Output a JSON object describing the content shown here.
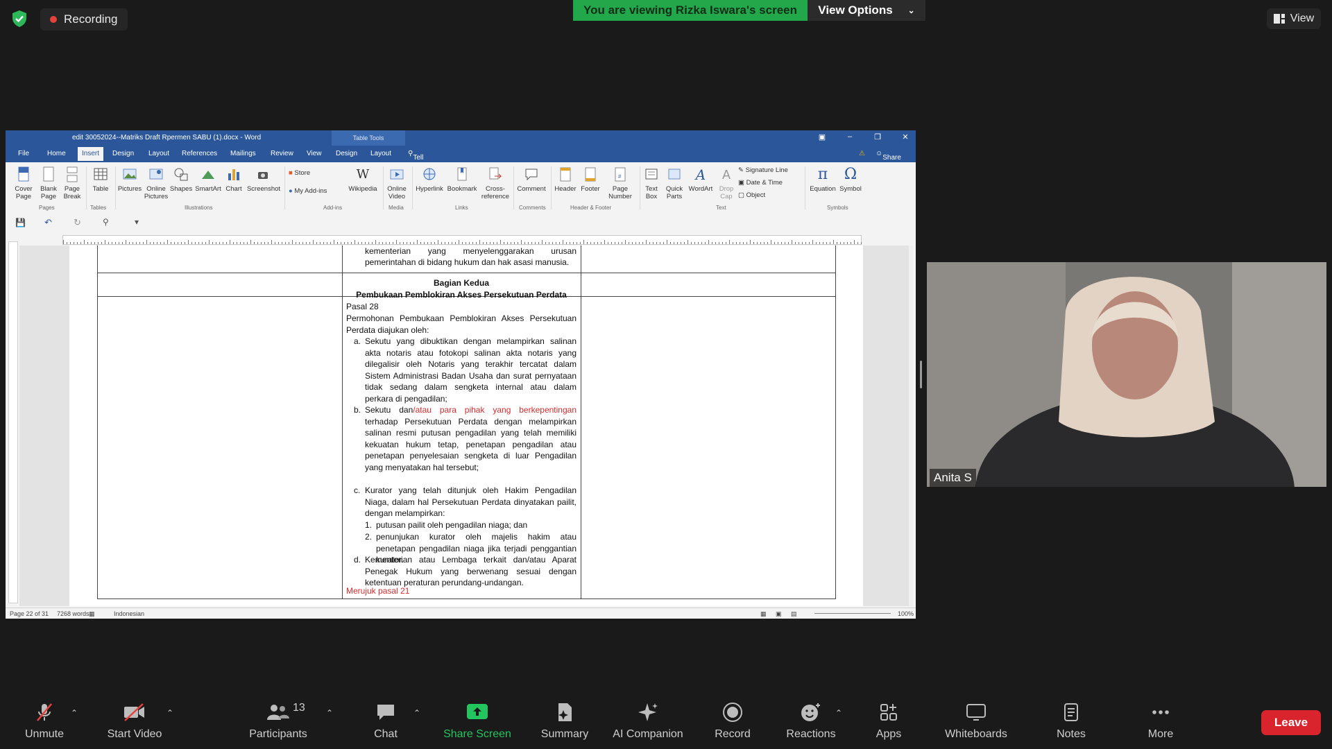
{
  "zoom": {
    "recording_label": "Recording",
    "banner_text": "You are viewing Rizka Iswara's screen",
    "view_options_label": "View Options",
    "view_button_label": "View",
    "participant_name": "Anita S",
    "participants_count": "13",
    "toolbar": {
      "unmute": "Unmute",
      "start_video": "Start Video",
      "participants": "Participants",
      "chat": "Chat",
      "share_screen": "Share Screen",
      "summary": "Summary",
      "ai_companion": "AI Companion",
      "record": "Record",
      "reactions": "Reactions",
      "apps": "Apps",
      "whiteboards": "Whiteboards",
      "notes": "Notes",
      "more": "More",
      "leave": "Leave"
    },
    "colors": {
      "accent_green": "#22a84a",
      "leave_red": "#d9232d",
      "share_green": "#22c55e"
    }
  },
  "word": {
    "title": "edit 30052024--Matriks Draft Rpermen SABU (1).docx - Word",
    "context_tab": "Table Tools",
    "tabs": [
      "File",
      "Home",
      "Insert",
      "Design",
      "Layout",
      "References",
      "Mailings",
      "Review",
      "View",
      "Design",
      "Layout"
    ],
    "tell_me": "Tell me what you want to do...",
    "share": "Share",
    "ribbon": {
      "cover_page": "Cover Page",
      "blank_page": "Blank Page",
      "page_break": "Page Break",
      "table": "Table",
      "pictures": "Pictures",
      "online_pictures": "Online Pictures",
      "shapes": "Shapes",
      "smartart": "SmartArt",
      "chart": "Chart",
      "screenshot": "Screenshot",
      "store": "Store",
      "my_addins": "My Add-ins",
      "wikipedia": "Wikipedia",
      "online_video": "Online Video",
      "hyperlink": "Hyperlink",
      "bookmark": "Bookmark",
      "cross_reference": "Cross-reference",
      "comment": "Comment",
      "header": "Header",
      "footer": "Footer",
      "page_number": "Page Number",
      "text_box": "Text Box",
      "quick_parts": "Quick Parts",
      "wordart": "WordArt",
      "drop_cap": "Drop Cap",
      "signature_line": "Signature Line",
      "date_time": "Date & Time",
      "object": "Object",
      "equation": "Equation",
      "symbol": "Symbol",
      "groups": {
        "pages": "Pages",
        "tables": "Tables",
        "illustrations": "Illustrations",
        "addins": "Add-ins",
        "media": "Media",
        "links": "Links",
        "comments": "Comments",
        "header_footer": "Header & Footer",
        "text": "Text",
        "symbols": "Symbols"
      }
    },
    "document": {
      "top_fragment_1": "kementerian yang menyelenggarakan urusan",
      "top_fragment_2": "pemerintahan di bidang hukum dan hak asasi manusia.",
      "section_title": "Bagian Kedua",
      "section_subtitle": "Pembukaan Pemblokiran Akses Persekutuan Perdata",
      "pasal": "Pasal 28",
      "intro": "Permohonan Pembukaan Pemblokiran Akses Persekutuan Perdata diajukan oleh:",
      "item_a_marker": "a.",
      "item_a": "Sekutu yang dibuktikan dengan melampirkan salinan akta notaris atau fotokopi salinan akta notaris yang dilegalisir oleh Notaris yang terakhir tercatat dalam Sistem Administrasi Badan Usaha dan surat pernyataan tidak sedang dalam sengketa internal atau dalam perkara di pengadilan;",
      "item_b_marker": "b.",
      "item_b_start": "Sekutu dan",
      "item_b_red": "/atau para pihak yang berkepentingan",
      "item_b_rest": "terhadap Persekutuan Perdata dengan melampirkan salinan resmi putusan pengadilan yang telah memiliki kekuatan hukum tetap, penetapan pengadilan atau penetapan penyelesaian sengketa di luar Pengadilan yang menyatakan hal tersebut;",
      "item_c_marker": "c.",
      "item_c": "Kurator yang telah ditunjuk oleh Hakim Pengadilan Niaga, dalam hal Persekutuan Perdata dinyatakan pailit, dengan melampirkan:",
      "sub_1_marker": "1.",
      "sub_1": "putusan pailit oleh pengadilan niaga; dan",
      "sub_2_marker": "2.",
      "sub_2": "penunjukan kurator oleh majelis hakim atau penetapan pengadilan niaga jika terjadi penggantian kurator.",
      "item_d_marker": "d.",
      "item_d": "Kementerian atau Lembaga terkait dan/atau Aparat Penegak Hukum yang berwenang sesuai dengan ketentuan peraturan perundang-undangan.",
      "reference_note": "Merujuk pasal 21"
    },
    "status": {
      "page": "Page 22 of 31",
      "words": "7268 words",
      "language": "Indonesian",
      "zoom": "100%"
    }
  }
}
